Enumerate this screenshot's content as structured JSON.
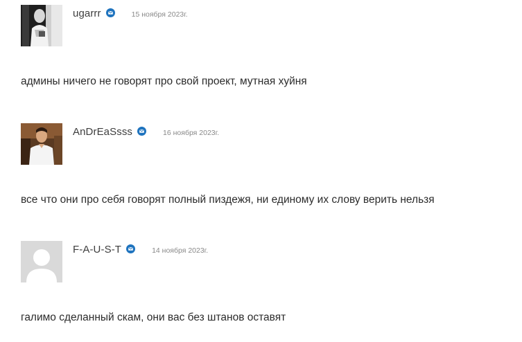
{
  "comments": [
    {
      "author": "ugarrr",
      "date": "15 ноября 2023г.",
      "text": "админы ничего не говорят про свой проект, мутная хуйня",
      "avatar": "photo-avatar",
      "verified_icon": "verified-badge-icon"
    },
    {
      "author": "AnDrEaSsss",
      "date": "16 ноября 2023г.",
      "text": "все что они про себя говорят полный пиздежя, ни единому их слову верить нельзя",
      "avatar": "photo-avatar",
      "verified_icon": "verified-badge-icon"
    },
    {
      "author": "F-A-U-S-T",
      "date": "14 ноября 2023г.",
      "text": "галимо сделанный скам, они вас без штанов оставят",
      "avatar": "default-avatar-placeholder",
      "verified_icon": "verified-badge-icon"
    }
  ],
  "colors": {
    "badge": "#1e73be",
    "text": "#2b2b2b",
    "date": "#888888",
    "placeholder_bg": "#d9d9d9"
  }
}
